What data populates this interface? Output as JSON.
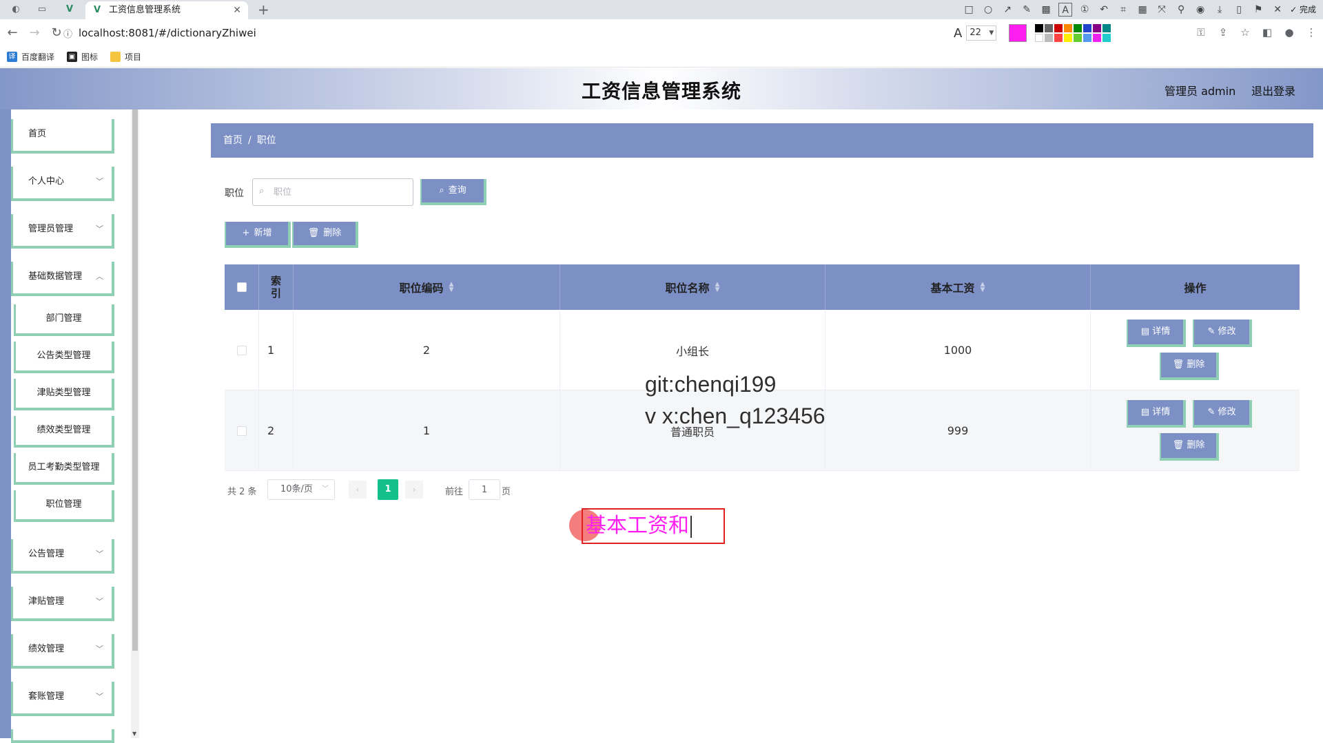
{
  "browser": {
    "tab_title": "工资信息管理系统",
    "url": "localhost:8081/#/dictionaryZhiwei",
    "bookmarks": [
      "百度翻译",
      "图标",
      "项目"
    ],
    "annot_font_size": "22",
    "annot_color": "#ff1ef0",
    "done_label": "完成"
  },
  "header": {
    "title": "工资信息管理系统",
    "admin_label": "管理员 admin",
    "logout_label": "退出登录"
  },
  "sidebar": {
    "items": [
      {
        "label": "首页"
      },
      {
        "label": "个人中心"
      },
      {
        "label": "管理员管理"
      },
      {
        "label": "基础数据管理"
      },
      {
        "label": "部门管理"
      },
      {
        "label": "公告类型管理"
      },
      {
        "label": "津贴类型管理"
      },
      {
        "label": "绩效类型管理"
      },
      {
        "label": "员工考勤类型管理"
      },
      {
        "label": "职位管理"
      },
      {
        "label": "公告管理"
      },
      {
        "label": "津贴管理"
      },
      {
        "label": "绩效管理"
      },
      {
        "label": "套账管理"
      }
    ]
  },
  "breadcrumb": {
    "home": "首页",
    "sep": "/",
    "current": "职位"
  },
  "search": {
    "label": "职位",
    "placeholder": "职位",
    "button": "查询"
  },
  "toolbar": {
    "add": "新增",
    "delete": "删除"
  },
  "table": {
    "headers": {
      "index": "索引",
      "code": "职位编码",
      "name": "职位名称",
      "salary": "基本工资",
      "ops": "操作"
    },
    "rows": [
      {
        "index": "1",
        "code": "2",
        "name": "小组长",
        "salary": "1000"
      },
      {
        "index": "2",
        "code": "1",
        "name": "普通职员",
        "salary": "999"
      }
    ],
    "op_labels": {
      "detail": "详情",
      "edit": "修改",
      "delete": "删除"
    }
  },
  "pagination": {
    "total": "共 2 条",
    "page_size": "10条/页",
    "current_page": "1",
    "goto_label": "前往",
    "goto_value": "1",
    "page_suffix": "页"
  },
  "overlays": {
    "watermark_line1": "git:chenqi199",
    "watermark_line2": "v x:chen_q123456",
    "annotation_text": "基本工资和"
  },
  "colors": {
    "accent": "#7c90c5",
    "border_accent": "#8fd0b5",
    "page_active": "#13c08a"
  }
}
